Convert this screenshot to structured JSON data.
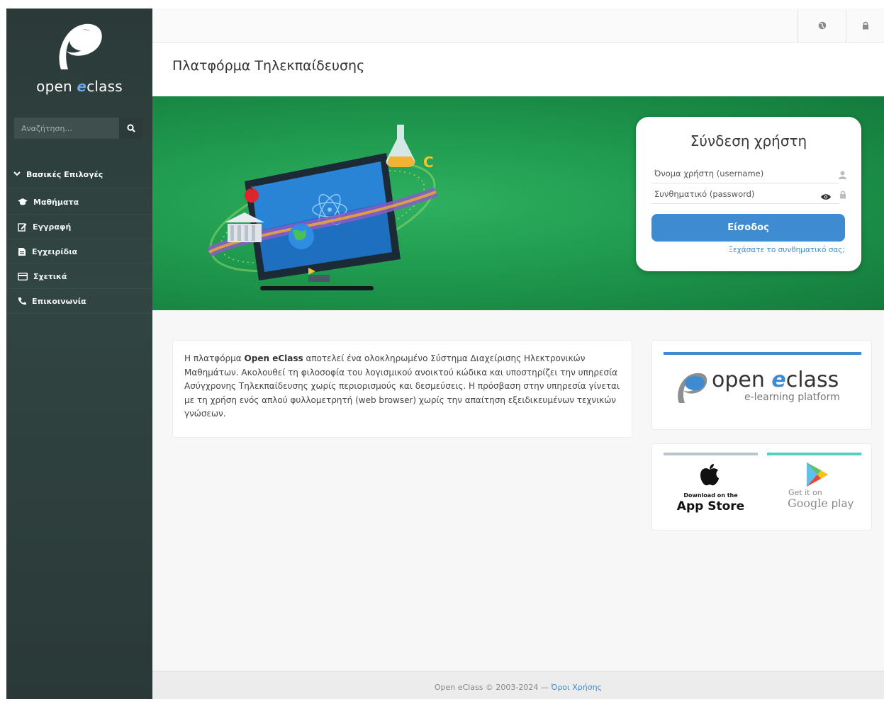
{
  "sidebar": {
    "logo_text_before": "open ",
    "logo_text_accent": "e",
    "logo_text_after": "class",
    "search_placeholder": "Αναζήτηση...",
    "section_title": "Βασικές Επιλογές",
    "items": [
      {
        "label": "Μαθήματα",
        "icon": "graduation-cap-icon"
      },
      {
        "label": "Εγγραφή",
        "icon": "edit-icon"
      },
      {
        "label": "Εγχειρίδια",
        "icon": "document-icon"
      },
      {
        "label": "Σχετικά",
        "icon": "credit-card-icon"
      },
      {
        "label": "Επικοινωνία",
        "icon": "phone-icon"
      }
    ]
  },
  "topbar": {
    "language_icon": "globe-icon",
    "login_icon": "lock-icon"
  },
  "page_title": "Πλατφόρμα Τηλεκπαίδευσης",
  "login": {
    "title": "Σύνδεση χρήστη",
    "username_placeholder": "Όνομα χρήστη (username)",
    "password_placeholder": "Συνθηματικό (password)",
    "submit_label": "Είσοδος",
    "forgot_label": "Ξεχάσατε το συνθηματικό σας;"
  },
  "intro": {
    "text_1": "Η πλατφόρμα ",
    "brand": "Open eClass",
    "text_2": " αποτελεί ένα ολοκληρωμένο Σύστημα Διαχείρισης Ηλεκτρονικών Μαθημάτων. Ακολουθεί τη φιλοσοφία του λογισμικού ανοικτού κώδικα και υποστηρίζει την υπηρεσία Ασύγχρονης Τηλεκπαίδευσης χωρίς περιορισμούς και δεσμεύσεις. Η πρόσβαση στην υπηρεσία γίνεται με τη χρήση ενός απλού φυλλομετρητή (web browser) χωρίς την απαίτηση εξειδικευμένων τεχνικών γνώσεων."
  },
  "brand_box": {
    "name_before": "open ",
    "name_accent": "e",
    "name_after": "class",
    "tagline": "e-learning platform"
  },
  "stores": {
    "apple_small": "Download on the",
    "apple_big": "App Store",
    "google_small": "Get it on",
    "google_big_1": "Google",
    "google_big_2": " play"
  },
  "footer": {
    "copyright": "Open eClass © 2003-2024 — ",
    "terms_label": "Όροι Χρήσης"
  },
  "colors": {
    "accent": "#3f8bd1",
    "sidebar_bg": "#2f403e",
    "hero_green": "#1f9a4e"
  }
}
